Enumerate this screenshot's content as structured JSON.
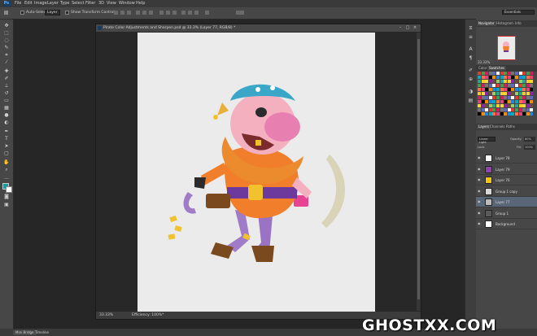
{
  "menubar": {
    "logo": "Ps",
    "items": [
      "File",
      "Edit",
      "Image",
      "Layer",
      "Type",
      "Select",
      "Filter",
      "3D",
      "View",
      "Window",
      "Help"
    ]
  },
  "options": {
    "auto_select_label": "Auto-Select:",
    "auto_select_value": "Layer",
    "show_transform_label": "Show Transform Controls",
    "workspace": "Essentials"
  },
  "document": {
    "title": "Pirate Color Adjustments and Sharpen.psd @ 33.3% (Layer 77, RGB/8) *",
    "zoom": "33.33%",
    "status": "Efficiency: 100%*"
  },
  "panels": {
    "top_tabs": [
      "Navigator",
      "Histogram",
      "Info"
    ],
    "color_tabs": [
      "Color",
      "Swatches"
    ],
    "swatch_colors": [
      "#e53935",
      "#fb8c00",
      "#fdd835",
      "#43a047",
      "#1e88e5",
      "#8e24aa",
      "#d81b60",
      "#00acc1",
      "#6d4c41",
      "#757575",
      "#ff7043",
      "#9ccc65",
      "#5c6bc0",
      "#ec407a",
      "#26a69a",
      "#ffffff",
      "#000000",
      "#ffca28"
    ],
    "layer_tabs": [
      "Layers",
      "Channels",
      "Paths"
    ],
    "blend_mode": "Linear Light",
    "opacity_label": "Opacity:",
    "opacity_value": "60%",
    "lock_label": "Lock:",
    "fill_label": "Fill:",
    "fill_value": "100%"
  },
  "layers": [
    {
      "name": "Layer 78",
      "thumb": "#ffffff",
      "selected": false
    },
    {
      "name": "Layer 79",
      "thumb": "#8e44ad",
      "selected": false
    },
    {
      "name": "Layer 76",
      "thumb": "#f1c40f",
      "selected": false
    },
    {
      "name": "Group 1 copy",
      "thumb": "#d8d8d8",
      "selected": false
    },
    {
      "name": "Layer 77",
      "thumb": "#bbbbbb",
      "selected": true
    },
    {
      "name": "Group 1",
      "thumb": "#5a5a5a",
      "selected": false
    },
    {
      "name": "Background",
      "thumb": "#ffffff",
      "selected": false
    }
  ],
  "bottom_tabs": [
    "Mini Bridge",
    "Timeline"
  ],
  "watermark": "GHOSTXX.COM",
  "colors": {
    "accent": "#596678",
    "canvas": "#ebebeb",
    "app_bg": "#262626"
  }
}
